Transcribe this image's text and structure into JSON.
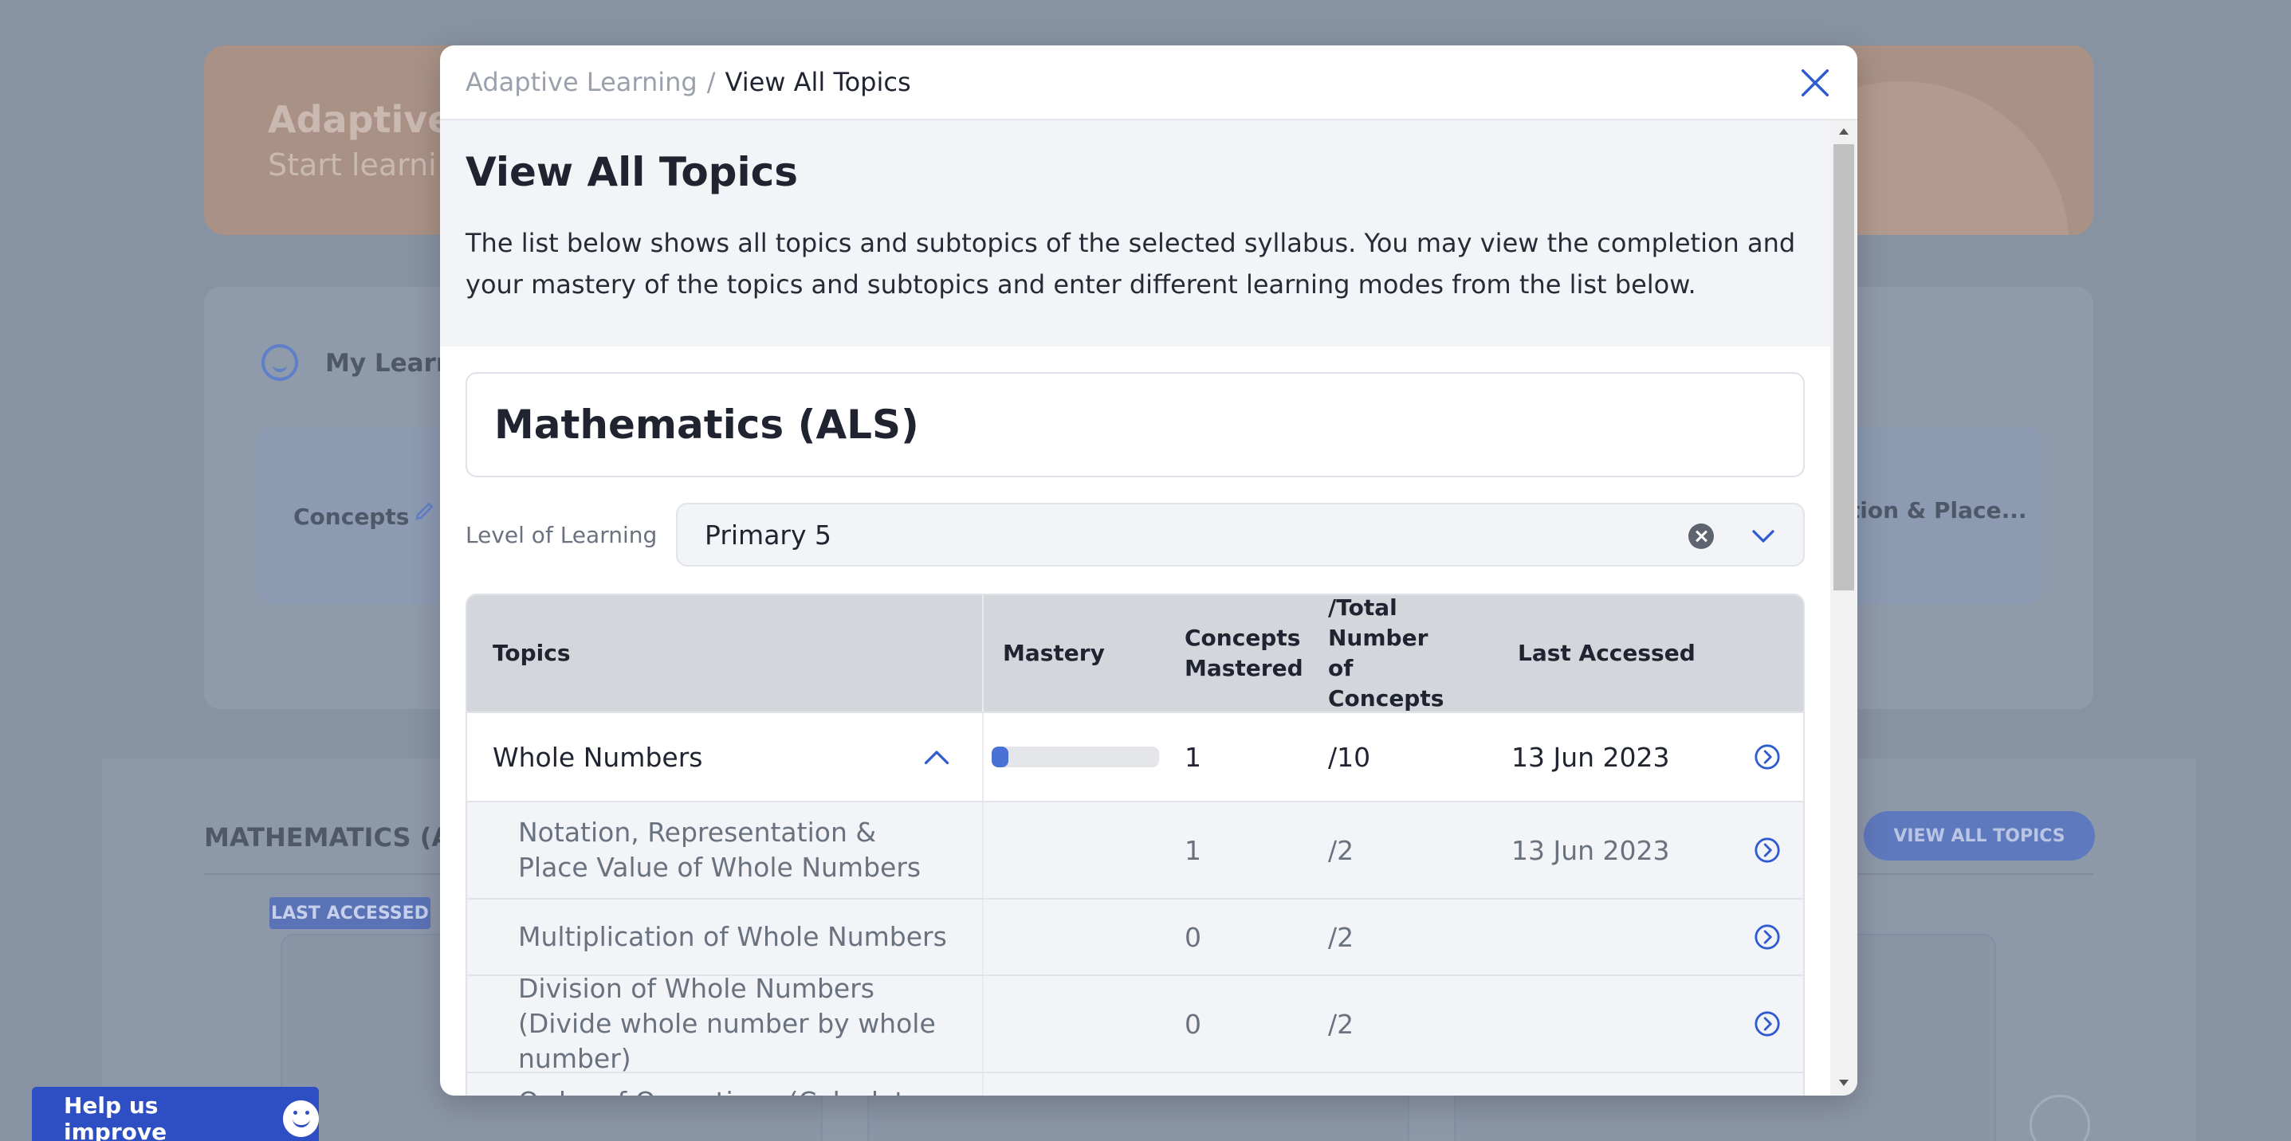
{
  "background": {
    "hero": {
      "title": "Adaptive",
      "subtitle": "Start learni"
    },
    "panel": {
      "title": "My Learn",
      "card_label": "Concepts",
      "card_right_text": "ation & Place..."
    },
    "lower": {
      "section_title": "MATHEMATICS (AL",
      "view_all_button": "VIEW ALL TOPICS",
      "badge": "LAST ACCESSED"
    }
  },
  "help": {
    "label": "Help us improve",
    "icon": "smiley-icon"
  },
  "modal": {
    "breadcrumb": {
      "root": "Adaptive Learning",
      "separator": "/",
      "current": "View All Topics"
    },
    "close_icon": "close-icon",
    "title": "View All Topics",
    "description": "The list below shows all topics and subtopics of the selected syllabus. You may view the completion and your mastery of the topics and subtopics and enter different learning modes from the list below.",
    "subject": "Mathematics (ALS)",
    "level": {
      "label": "Level of Learning",
      "value": "Primary 5"
    },
    "table": {
      "headers": {
        "topics": "Topics",
        "mastery": "Mastery",
        "mastered": "Concepts Mastered",
        "total": "/Total Number of Concepts",
        "last": "Last Accessed"
      },
      "topic": {
        "name": "Whole Numbers",
        "mastery_fraction": 0.1,
        "mastered": "1",
        "total": "/10",
        "last": "13 Jun 2023"
      },
      "subtopics": [
        {
          "name": "Notation, Representation & Place Value of Whole Numbers",
          "mastered": "1",
          "total": "/2",
          "last": "13 Jun 2023"
        },
        {
          "name": "Multiplication of Whole Numbers",
          "mastered": "0",
          "total": "/2",
          "last": ""
        },
        {
          "name": "Division of Whole Numbers (Divide whole number by whole number)",
          "mastered": "0",
          "total": "/2",
          "last": ""
        },
        {
          "name": "Order of Operations (Calculate",
          "mastered": "",
          "total": "",
          "last": ""
        }
      ]
    },
    "colors": {
      "accent": "#2f5bd1",
      "progress": "#4a72d6"
    }
  }
}
